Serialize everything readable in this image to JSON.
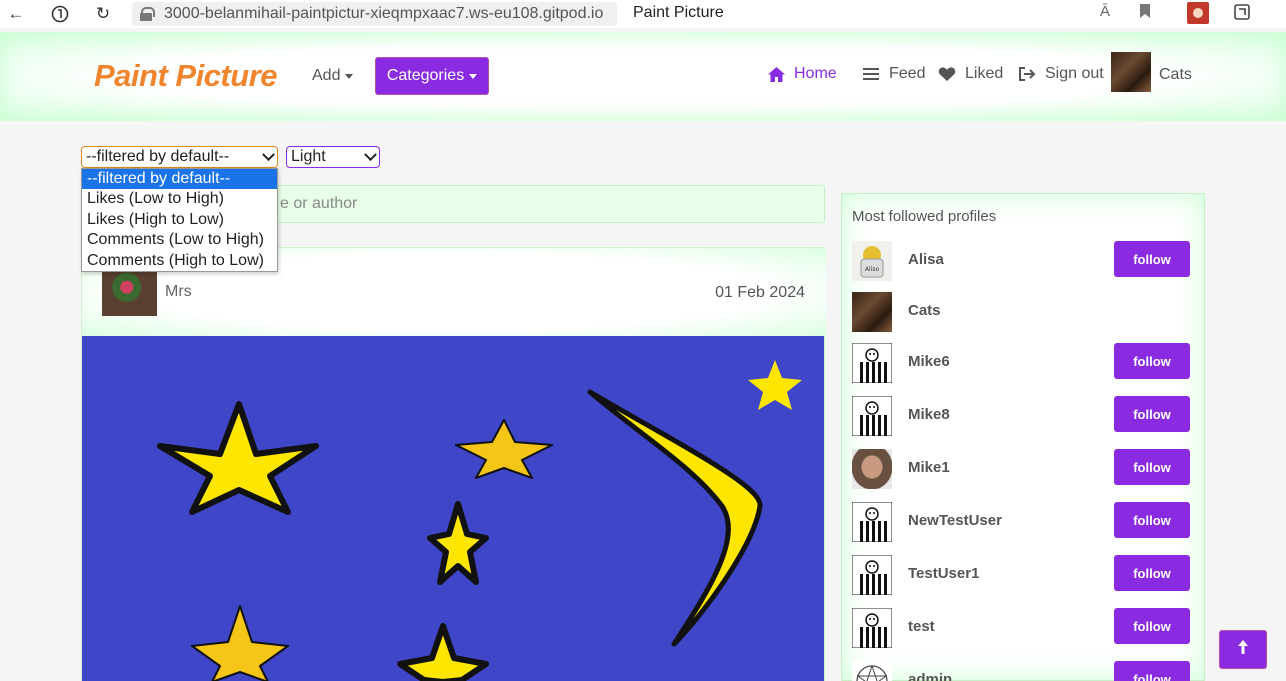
{
  "browser": {
    "url": "3000-belanmihail-paintpictur-xieqmpxaac7.ws-eu108.gitpod.io",
    "tab_title": "Paint Picture"
  },
  "nav": {
    "brand": "Paint Picture",
    "add_label": "Add",
    "categories_label": "Categories",
    "home_label": "Home",
    "feed_label": "Feed",
    "liked_label": "Liked",
    "signout_label": "Sign out",
    "user_label": "Cats",
    "accent": "#8a2be2",
    "brand_color": "#f0852d"
  },
  "filters": {
    "sort_value": "--filtered by default--",
    "theme_value": "Light",
    "sort_options": [
      "--filtered by default--",
      "Likes (Low to High)",
      "Likes (High to Low)",
      "Comments (Low to High)",
      "Comments (High to Low)"
    ]
  },
  "search": {
    "visible_placeholder": "e or author"
  },
  "post": {
    "author": "Mrs",
    "date": "01 Feb 2024"
  },
  "sidebar": {
    "title": "Most followed profiles",
    "follow_label": "follow",
    "profiles": [
      {
        "name": "Alisa",
        "avatar": "alisa",
        "follow": true
      },
      {
        "name": "Cats",
        "avatar": "cats",
        "follow": false
      },
      {
        "name": "Mike6",
        "avatar": "stripe",
        "follow": true
      },
      {
        "name": "Mike8",
        "avatar": "stripe",
        "follow": true
      },
      {
        "name": "Mike1",
        "avatar": "photo",
        "follow": true
      },
      {
        "name": "NewTestUser",
        "avatar": "stripe",
        "follow": true
      },
      {
        "name": "TestUser1",
        "avatar": "stripe",
        "follow": true
      },
      {
        "name": "test",
        "avatar": "stripe",
        "follow": true
      },
      {
        "name": "admin",
        "avatar": "pentagram",
        "follow": true
      }
    ]
  }
}
